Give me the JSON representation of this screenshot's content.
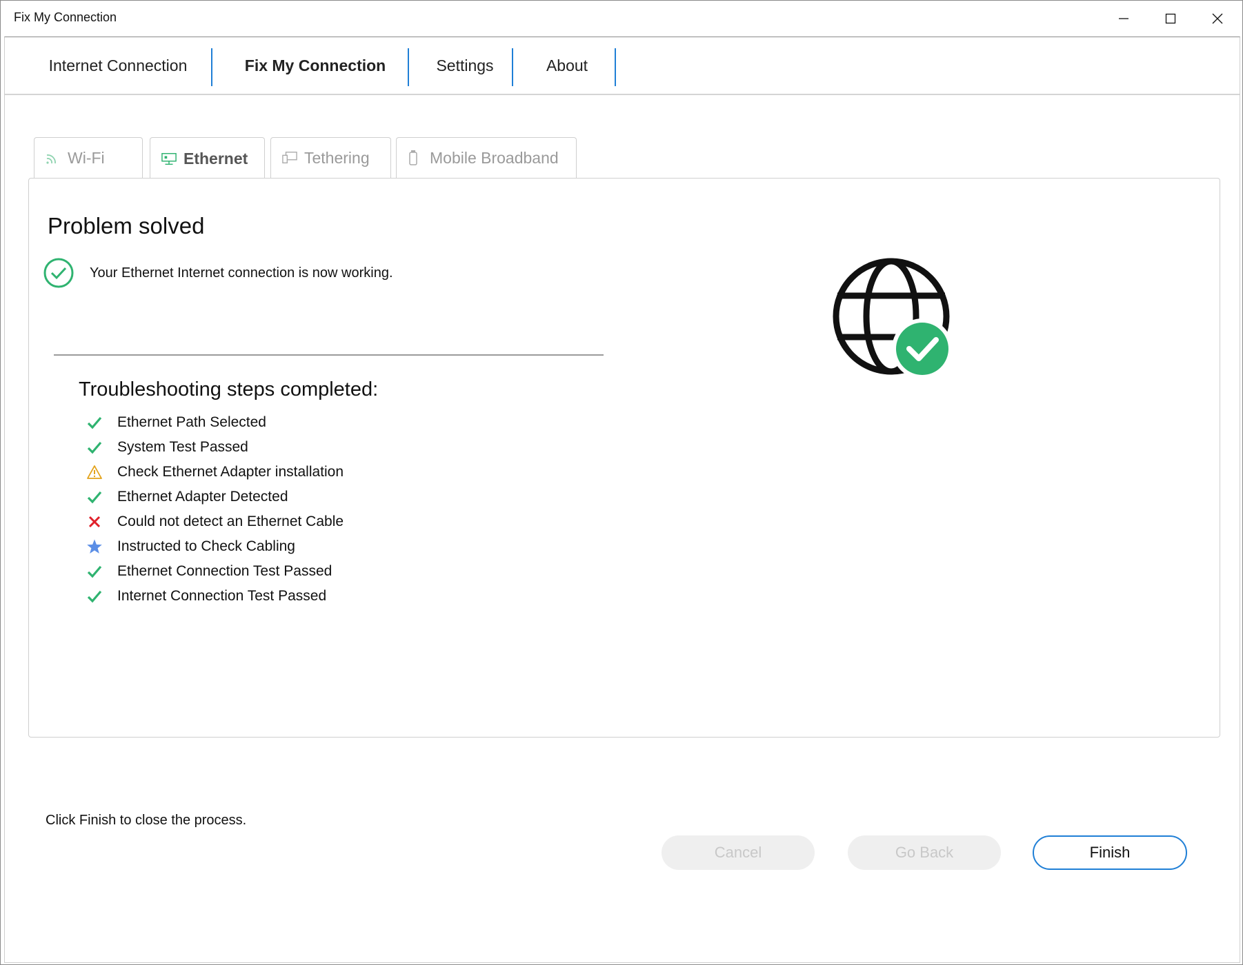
{
  "window": {
    "title": "Fix My Connection",
    "controls": [
      "minimize",
      "maximize",
      "close"
    ]
  },
  "top_nav": {
    "items": [
      {
        "label": "Internet Connection",
        "active": false
      },
      {
        "label": "Fix My Connection",
        "active": true
      },
      {
        "label": "Settings",
        "active": false
      },
      {
        "label": "About",
        "active": false
      }
    ]
  },
  "tabs": [
    {
      "label": "Wi-Fi",
      "icon": "wifi-icon",
      "active": false
    },
    {
      "label": "Ethernet",
      "icon": "ethernet-icon",
      "active": true
    },
    {
      "label": "Tethering",
      "icon": "tethering-icon",
      "active": false
    },
    {
      "label": "Mobile Broadband",
      "icon": "mobile-broadband-icon",
      "active": false
    }
  ],
  "panel": {
    "title": "Problem solved",
    "status_text": "Your Ethernet Internet connection is now working.",
    "steps_title": "Troubleshooting steps completed:",
    "steps": [
      {
        "label": "Ethernet Path Selected",
        "status": "success"
      },
      {
        "label": "System Test Passed",
        "status": "success"
      },
      {
        "label": "Check Ethernet Adapter installation",
        "status": "warning"
      },
      {
        "label": "Ethernet Adapter Detected",
        "status": "success"
      },
      {
        "label": "Could not detect an Ethernet Cable",
        "status": "error"
      },
      {
        "label": "Instructed to Check Cabling",
        "status": "info"
      },
      {
        "label": "Ethernet Connection Test Passed",
        "status": "success"
      },
      {
        "label": "Internet Connection Test Passed",
        "status": "success"
      }
    ]
  },
  "footer": {
    "hint": "Click Finish to close the process.",
    "cancel_label": "Cancel",
    "go_back_label": "Go Back",
    "finish_label": "Finish"
  },
  "colors": {
    "accent": "#1f7fd6",
    "success": "#2fb370",
    "warning": "#e3a21a",
    "error": "#e0202a",
    "info": "#5b8ee6"
  }
}
